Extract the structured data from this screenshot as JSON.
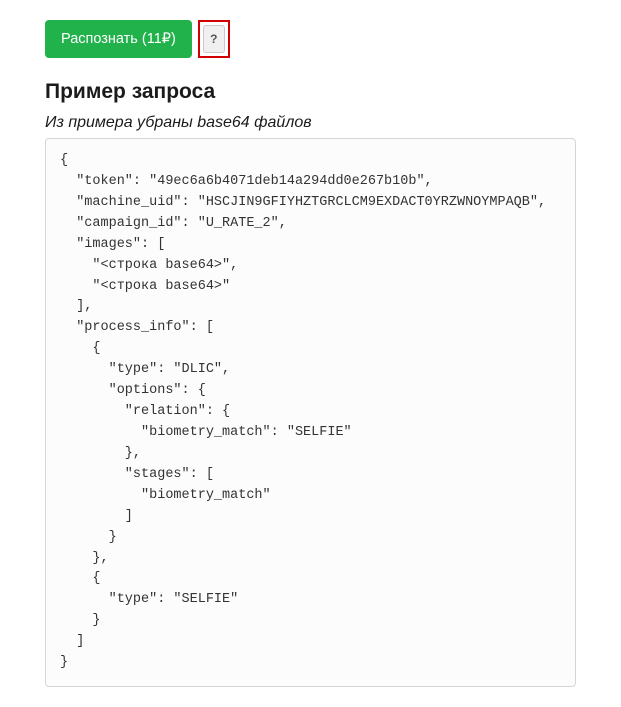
{
  "actions": {
    "recognize_label": "Распознать (11₽)",
    "help_label": "?"
  },
  "section": {
    "title": "Пример запроса",
    "subtitle": "Из примера убраны base64 файлов"
  },
  "code": "{\n  \"token\": \"49ec6a6b4071deb14a294dd0e267b10b\",\n  \"machine_uid\": \"HSCJIN9GFIYHZTGRCLCM9EXDACT0YRZWNOYMPAQB\",\n  \"campaign_id\": \"U_RATE_2\",\n  \"images\": [\n    \"<строка base64>\",\n    \"<строка base64>\"\n  ],\n  \"process_info\": [\n    {\n      \"type\": \"DLIC\",\n      \"options\": {\n        \"relation\": {\n          \"biometry_match\": \"SELFIE\"\n        },\n        \"stages\": [\n          \"biometry_match\"\n        ]\n      }\n    },\n    {\n      \"type\": \"SELFIE\"\n    }\n  ]\n}"
}
